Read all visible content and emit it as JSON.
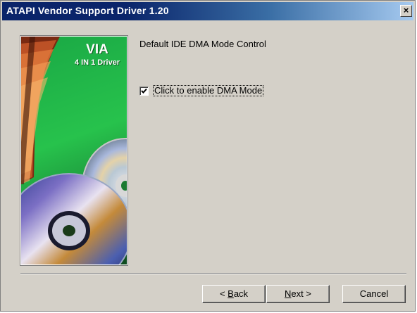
{
  "window": {
    "title": "ATAPI Vendor Support Driver 1.20",
    "close_label": "×"
  },
  "banner": {
    "title": "VIA",
    "subtitle": "4 IN 1 Driver"
  },
  "content": {
    "heading": "Default IDE DMA Mode Control",
    "checkbox": {
      "label": "Click to enable DMA Mode",
      "checked": true
    }
  },
  "buttons": {
    "back": {
      "mnemonic": "B",
      "rest": "ack",
      "prefix": "< "
    },
    "next": {
      "mnemonic": "N",
      "rest": "ext",
      "suffix": " >"
    },
    "cancel": "Cancel"
  }
}
